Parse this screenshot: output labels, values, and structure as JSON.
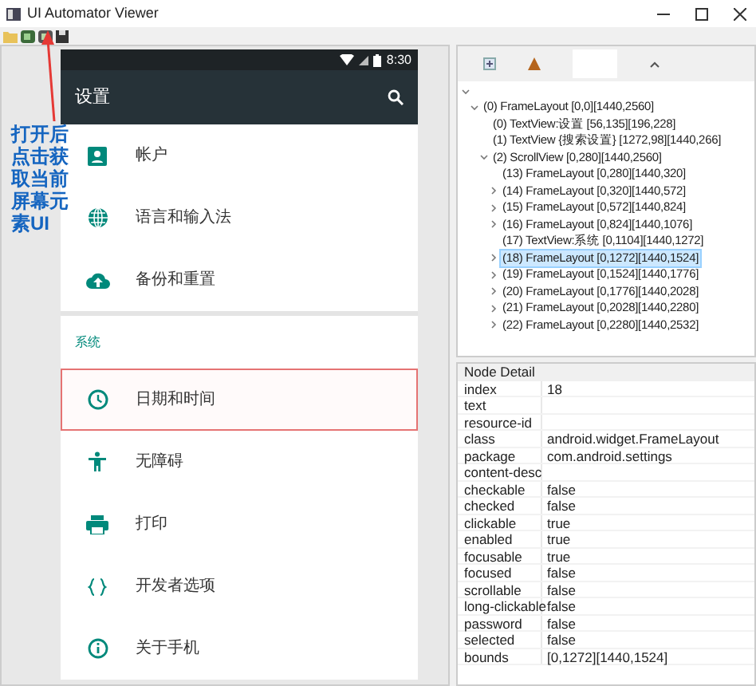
{
  "window": {
    "title": "UI Automator Viewer"
  },
  "toolbar": [
    {
      "kind": "open"
    },
    {
      "kind": "device"
    },
    {
      "kind": "device-compressed"
    },
    {
      "kind": "save"
    }
  ],
  "annotation": {
    "text": "打开后点击获取当前屏幕元素UI"
  },
  "device": {
    "clock": "8:30",
    "app_title": "设置",
    "items": [
      {
        "kind": "account",
        "label": "帐户",
        "selected": false
      },
      {
        "kind": "globe",
        "label": "语言和输入法",
        "selected": false
      },
      {
        "kind": "cloud",
        "label": "备份和重置",
        "selected": false
      },
      {
        "kind": "header",
        "label": "系统"
      },
      {
        "kind": "clock",
        "label": "日期和时间",
        "selected": true
      },
      {
        "kind": "accessibility",
        "label": "无障碍",
        "selected": false
      },
      {
        "kind": "print",
        "label": "打印",
        "selected": false
      },
      {
        "kind": "braces",
        "label": "开发者选项",
        "selected": false
      },
      {
        "kind": "info",
        "label": "关于手机",
        "selected": false
      }
    ]
  },
  "tree": {
    "children": [
      {
        "label": "(0) FrameLayout [0,0][1440,2560]",
        "expanded": true,
        "selected": false,
        "children": [
          {
            "label": "(0) TextView:设置 [56,135][196,228]",
            "selected": false
          },
          {
            "label": "(1) TextView {搜索设置} [1272,98][1440,266]",
            "selected": false
          },
          {
            "label": "(2) ScrollView [0,280][1440,2560]",
            "expanded": true,
            "selected": false,
            "children": [
              {
                "label": "(13) FrameLayout [0,280][1440,320]",
                "selected": false
              },
              {
                "label": "(14) FrameLayout [0,320][1440,572]",
                "expanded": false,
                "selected": false
              },
              {
                "label": "(15) FrameLayout [0,572][1440,824]",
                "expanded": false,
                "selected": false
              },
              {
                "label": "(16) FrameLayout [0,824][1440,1076]",
                "expanded": false,
                "selected": false
              },
              {
                "label": "(17) TextView:系统 [0,1104][1440,1272]",
                "selected": false
              },
              {
                "label": "(18) FrameLayout [0,1272][1440,1524]",
                "expanded": false,
                "selected": true
              },
              {
                "label": "(19) FrameLayout [0,1524][1440,1776]",
                "expanded": false,
                "selected": false
              },
              {
                "label": "(20) FrameLayout [0,1776][1440,2028]",
                "expanded": false,
                "selected": false
              },
              {
                "label": "(21) FrameLayout [0,2028][1440,2280]",
                "expanded": false,
                "selected": false
              },
              {
                "label": "(22) FrameLayout [0,2280][1440,2532]",
                "expanded": false,
                "selected": false
              }
            ]
          }
        ]
      }
    ]
  },
  "node_detail": {
    "title": "Node Detail",
    "rows": [
      {
        "key": "index",
        "value": "18"
      },
      {
        "key": "text"
      },
      {
        "key": "resource-id"
      },
      {
        "key": "class",
        "value": "android.widget.FrameLayout"
      },
      {
        "key": "package",
        "value": "com.android.settings"
      },
      {
        "key": "content-desc"
      },
      {
        "key": "checkable",
        "value": "false"
      },
      {
        "key": "checked",
        "value": "false"
      },
      {
        "key": "clickable",
        "value": "true"
      },
      {
        "key": "enabled",
        "value": "true"
      },
      {
        "key": "focusable",
        "value": "true"
      },
      {
        "key": "focused",
        "value": "false"
      },
      {
        "key": "scrollable",
        "value": "false"
      },
      {
        "key": "long-clickable",
        "value": "false"
      },
      {
        "key": "password",
        "value": "false"
      },
      {
        "key": "selected",
        "value": "false"
      },
      {
        "key": "bounds",
        "value": "[0,1272][1440,1524]"
      }
    ]
  }
}
